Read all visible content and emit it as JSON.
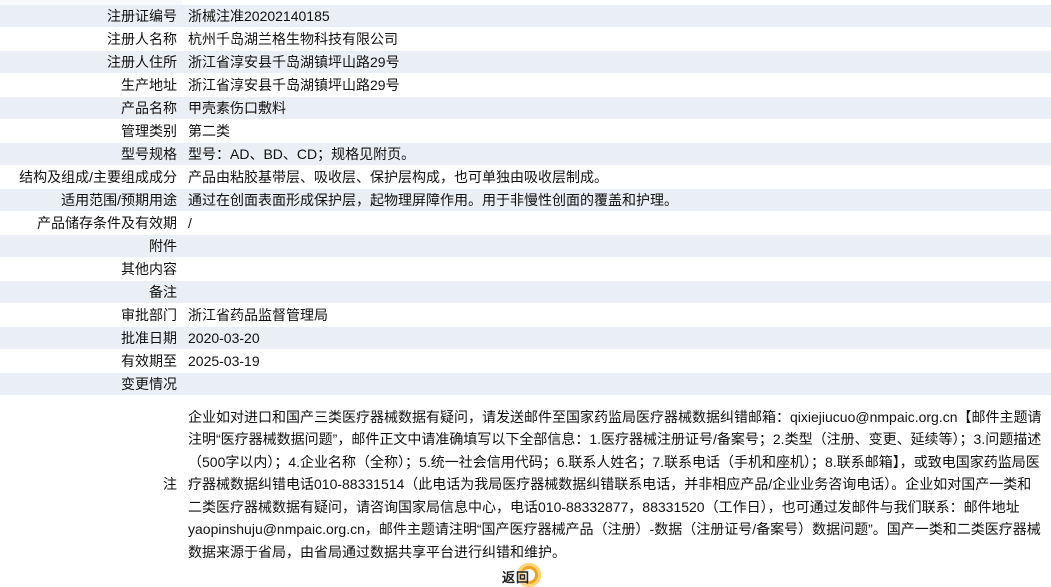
{
  "rows": [
    {
      "label": "注册证编号",
      "value": "浙械注准20202140185"
    },
    {
      "label": "注册人名称",
      "value": "杭州千岛湖兰格生物科技有限公司"
    },
    {
      "label": "注册人住所",
      "value": "浙江省淳安县千岛湖镇坪山路29号"
    },
    {
      "label": "生产地址",
      "value": "浙江省淳安县千岛湖镇坪山路29号"
    },
    {
      "label": "产品名称",
      "value": "甲壳素伤口敷料"
    },
    {
      "label": "管理类别",
      "value": "第二类"
    },
    {
      "label": "型号规格",
      "value": "型号：AD、BD、CD；规格见附页。"
    },
    {
      "label": "结构及组成/主要组成成分",
      "value": "产品由粘胶基带层、吸收层、保护层构成，也可单独由吸收层制成。"
    },
    {
      "label": "适用范围/预期用途",
      "value": "通过在创面表面形成保护层，起物理屏障作用。用于非慢性创面的覆盖和护理。"
    },
    {
      "label": "产品储存条件及有效期",
      "value": "/"
    },
    {
      "label": "附件",
      "value": ""
    },
    {
      "label": "其他内容",
      "value": ""
    },
    {
      "label": "备注",
      "value": ""
    },
    {
      "label": "审批部门",
      "value": "浙江省药品监督管理局"
    },
    {
      "label": "批准日期",
      "value": "2020-03-20"
    },
    {
      "label": "有效期至",
      "value": "2025-03-19"
    },
    {
      "label": "变更情况",
      "value": ""
    }
  ],
  "note": {
    "label": "注",
    "text": "企业如对进口和国产三类医疗器械数据有疑问，请发送邮件至国家药监局医疗器械数据纠错邮箱：qixiejiucuo@nmpaic.org.cn【邮件主题请注明“医疗器械数据问题”，邮件正文中请准确填写以下全部信息：1.医疗器械注册证号/备案号；2.类型（注册、变更、延续等）；3.问题描述（500字以内）；4.企业名称（全称）；5.统一社会信用代码；6.联系人姓名；7.联系电话（手机和座机）；8.联系邮箱】，或致电国家药监局医疗器械数据纠错电话010-88331514（此电话为我局医疗器械数据纠错联系电话，并非相应产品/企业业务咨询电话）。企业如对国产一类和二类医疗器械数据有疑问，请咨询国家局信息中心，电话010-88332877，88331520（工作日），也可通过发邮件与我们联系：邮件地址yaopinshuju@nmpaic.org.cn，邮件主题请注明“国产医疗器械产品（注册）-数据（注册证号/备案号）数据问题”。国产一类和二类医疗器械数据来源于省局，由省局通过数据共享平台进行纠错和维护。"
  },
  "back_button": {
    "label": "返回"
  },
  "colors": {
    "row_shade": "#eaeef5",
    "accent": "#4f86c6",
    "button": "#f3a21b"
  }
}
